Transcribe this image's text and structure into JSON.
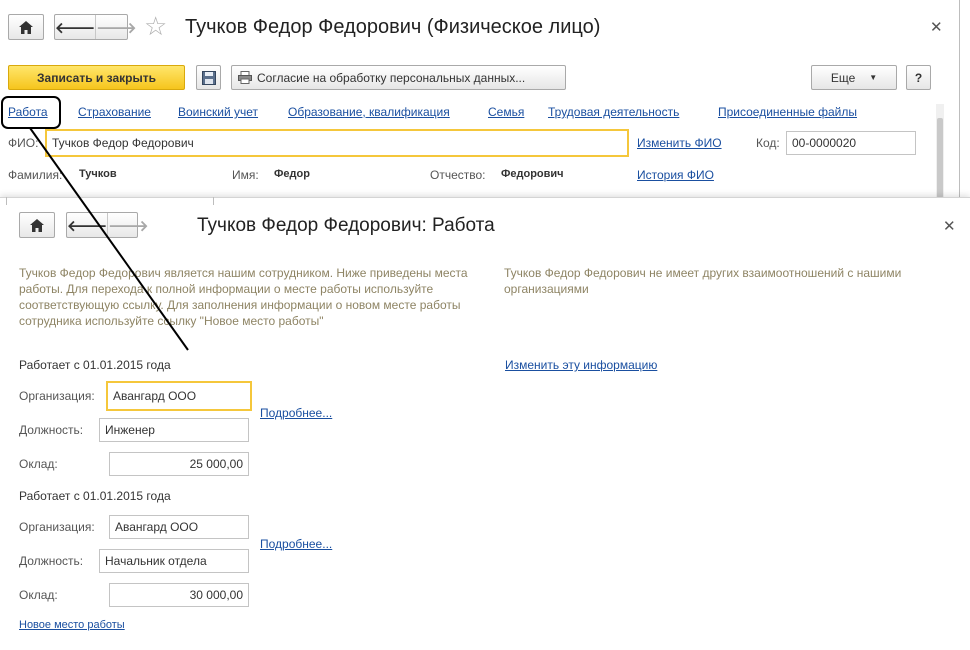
{
  "main": {
    "title": "Тучков Федор Федорович (Физическое лицо)",
    "toolbar": {
      "save_close": "Записать и закрыть",
      "consent": "Согласие на обработку персональных данных...",
      "more": "Еще",
      "more_arrow": "▼",
      "help": "?"
    },
    "tabs": [
      "Работа",
      "Страхование",
      "Воинский учет",
      "Образование, квалификация",
      "Семья",
      "Трудовая деятельность",
      "Присоединенные файлы"
    ],
    "fio_label": "ФИО:",
    "fio_value": "Тучков Федор Федорович",
    "change_fio": "Изменить ФИО",
    "code_label": "Код:",
    "code_value": "00-0000020",
    "surname_label": "Фамилия:",
    "surname_value": "Тучков",
    "name_label": "Имя:",
    "name_value": "Федор",
    "patronymic_label": "Отчество:",
    "patronymic_value": "Федорович",
    "fio_history": "История ФИО"
  },
  "popup": {
    "title": "Тучков Федор Федорович: Работа",
    "info_left": "Тучков Федор Федорович является нашим сотрудником. Ниже приведены места работы. Для перехода к полной информации о месте работы используйте соответствующую ссылку. Для заполнения информации о новом месте работы сотрудника используйте ссылку \"Новое место работы\"",
    "info_right": "Тучков Федор Федорович не имеет других взаимоотношений с нашими организациями",
    "change_info": "Изменить эту информацию",
    "jobs": [
      {
        "since": "Работает с 01.01.2015 года",
        "org_label": "Организация:",
        "org": "Авангард ООО",
        "pos_label": "Должность:",
        "pos": "Инженер",
        "salary_label": "Оклад:",
        "salary": "25 000,00",
        "more": "Подробнее..."
      },
      {
        "since": "Работает с 01.01.2015 года",
        "org_label": "Организация:",
        "org": "Авангард ООО",
        "pos_label": "Должность:",
        "pos": "Начальник отдела",
        "salary_label": "Оклад:",
        "salary": "30 000,00",
        "more": "Подробнее..."
      }
    ],
    "new_job": "Новое место работы"
  },
  "icons": {
    "home": "home-icon",
    "back": "arrow-left-icon",
    "forward": "arrow-right-icon",
    "star": "star-icon",
    "close": "close-icon",
    "save": "floppy-disk-icon",
    "print": "printer-icon"
  },
  "colors": {
    "primary_button": "#f6c51d",
    "link": "#1a4fa0",
    "focus_border": "#f5c73b",
    "hint_text": "#8e8464"
  }
}
